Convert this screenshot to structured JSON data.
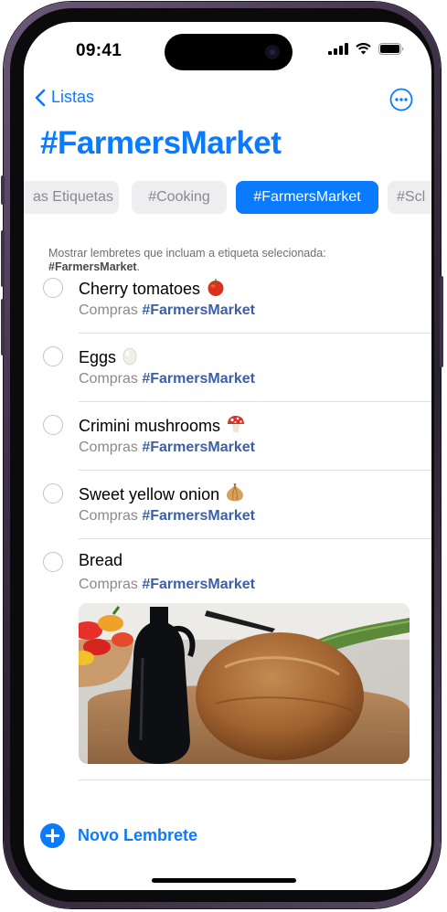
{
  "status_bar": {
    "time": "09:41"
  },
  "nav": {
    "back_label": "Listas"
  },
  "page": {
    "title": "#FarmersMarket"
  },
  "tag_chips": [
    {
      "label": "as Etiquetas",
      "selected": false
    },
    {
      "label": "#Cooking",
      "selected": false
    },
    {
      "label": "#FarmersMarket",
      "selected": true
    },
    {
      "label": "#Scl",
      "selected": false
    }
  ],
  "hint": {
    "text": "Mostrar lembretes que incluam a etiqueta selecionada:",
    "tag": "#FarmersMarket",
    "suffix": "."
  },
  "reminders": [
    {
      "title": "Cherry tomatoes",
      "emoji": "tomato-icon",
      "list": "Compras",
      "tag": "#FarmersMarket"
    },
    {
      "title": "Eggs",
      "emoji": "egg-icon",
      "list": "Compras",
      "tag": "#FarmersMarket"
    },
    {
      "title": "Crimini mushrooms",
      "emoji": "mushroom-icon",
      "list": "Compras",
      "tag": "#FarmersMarket"
    },
    {
      "title": "Sweet yellow onion",
      "emoji": "onion-icon",
      "list": "Compras",
      "tag": "#FarmersMarket"
    },
    {
      "title": "Bread",
      "emoji": null,
      "list": "Compras",
      "tag": "#FarmersMarket",
      "image": "bread-photo"
    }
  ],
  "footer": {
    "new_reminder_label": "Novo Lembrete"
  },
  "colors": {
    "accent": "#0a7aff",
    "tag": "#3b5fa8",
    "secondary_text": "#8a8a8e",
    "chip_bg": "#eeeef0",
    "frame": "#3e3148"
  }
}
